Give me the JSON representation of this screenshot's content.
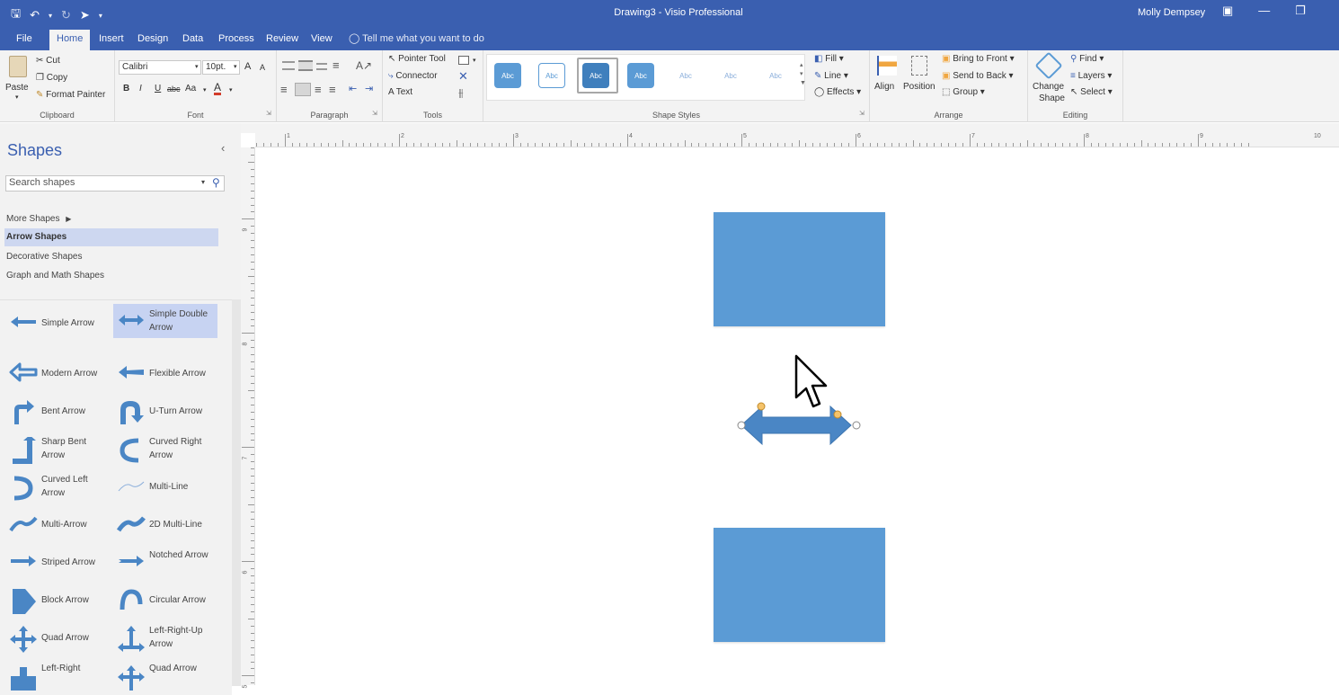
{
  "window": {
    "title": "Drawing3  -  Visio Professional",
    "user": "Molly Dempsey"
  },
  "tabs": [
    "File",
    "Home",
    "Insert",
    "Design",
    "Data",
    "Process",
    "Review",
    "View"
  ],
  "active_tab": "Home",
  "tell_me": "Tell me what you want to do",
  "ribbon": {
    "clipboard": {
      "paste": "Paste",
      "cut": "Cut",
      "copy": "Copy",
      "format_painter": "Format Painter",
      "label": "Clipboard"
    },
    "font": {
      "family": "Calibri",
      "size": "10pt.",
      "label": "Font",
      "bold": "B",
      "italic": "I",
      "underline": "U",
      "strike": "abc",
      "case": "Aa",
      "color": "A",
      "grow": "A",
      "shrink": "A"
    },
    "paragraph": {
      "label": "Paragraph"
    },
    "tools": {
      "pointer": "Pointer Tool",
      "connector": "Connector",
      "text": "Text",
      "label": "Tools"
    },
    "shape_styles": {
      "tiles": [
        "Abc",
        "Abc",
        "Abc",
        "Abc",
        "Abc",
        "Abc",
        "Abc"
      ],
      "fill": "Fill",
      "line": "Line",
      "effects": "Effects",
      "label": "Shape Styles"
    },
    "arrange": {
      "align": "Align",
      "position": "Position",
      "bring_front": "Bring to Front",
      "send_back": "Send to Back",
      "group": "Group",
      "label": "Arrange"
    },
    "editing": {
      "change_shape_1": "Change",
      "change_shape_2": "Shape",
      "find": "Find",
      "layers": "Layers",
      "select": "Select",
      "label": "Editing"
    }
  },
  "pane": {
    "title": "Shapes",
    "search_placeholder": "Search shapes",
    "more_shapes": "More Shapes",
    "stencils": [
      "Arrow Shapes",
      "Decorative Shapes",
      "Graph and Math Shapes"
    ],
    "selected_stencil": "Arrow Shapes",
    "shapes": [
      "Simple Arrow",
      "Simple Double Arrow",
      "Modern Arrow",
      "Flexible Arrow",
      "Bent Arrow",
      "U-Turn Arrow",
      "Sharp Bent Arrow",
      "Curved Right Arrow",
      "Curved Left Arrow",
      "Multi-Line",
      "Multi-Arrow",
      "2D Multi-Line",
      "Striped Arrow",
      "Notched Arrow",
      "Block Arrow",
      "Circular Arrow",
      "Quad Arrow",
      "Left-Right-Up Arrow",
      "Left-Right",
      "Quad Arrow"
    ]
  },
  "ruler": {
    "h_numbers": [
      "1",
      "2",
      "3",
      "4",
      "5",
      "6",
      "7",
      "8",
      "9",
      "10"
    ],
    "v_numbers": [
      "9",
      "8",
      "7",
      "6",
      "5"
    ]
  },
  "colors": {
    "brand": "#3a5fb0",
    "shape_fill": "#5b9bd5",
    "arrow_fill": "#4a86c5"
  }
}
